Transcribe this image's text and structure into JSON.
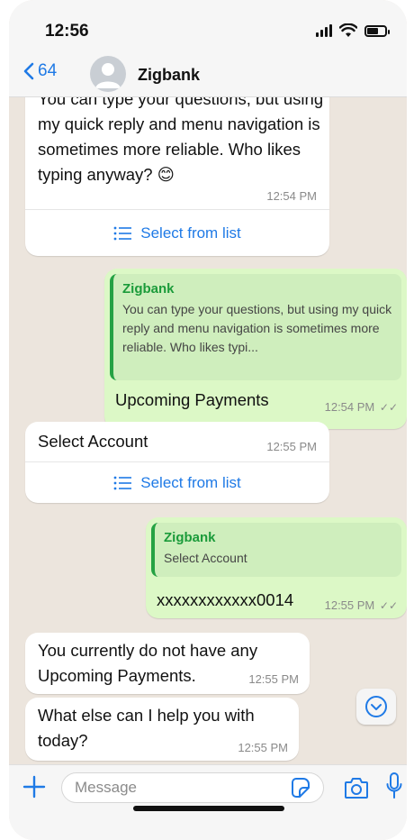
{
  "status": {
    "time": "12:56"
  },
  "nav": {
    "back_count": "64",
    "contact_name": "Zigbank"
  },
  "messages": {
    "m1": {
      "text": "You can type your questions, but using my quick reply and menu navigation is sometimes more reliable.  Who likes typing anyway? 😊",
      "time": "12:54 PM",
      "list_label": "Select from list"
    },
    "m2": {
      "quote_title": "Zigbank",
      "quote_text": "You can type your questions, but using my quick reply and menu navigation is sometimes more reliable.  Who likes typi...",
      "text": "Upcoming Payments",
      "time": "12:54 PM"
    },
    "m3": {
      "text": "Select Account",
      "time": "12:55 PM",
      "list_label": "Select from list"
    },
    "m4": {
      "quote_title": "Zigbank",
      "quote_text": "Select Account",
      "text": "xxxxxxxxxxxx0014",
      "time": "12:55 PM"
    },
    "m5": {
      "text": "You currently do not have any Upcoming Payments.",
      "time": "12:55 PM"
    },
    "m6": {
      "text": "What else can I help you with today?",
      "time": "12:55 PM"
    }
  },
  "composer": {
    "placeholder": "Message"
  },
  "colors": {
    "accent": "#1f7ae6",
    "outgoing_bubble": "#dcf8c6",
    "quote_green": "#1b9b3a",
    "chat_bg": "#ece5dd"
  },
  "icons": [
    "back-chevron-icon",
    "avatar-icon",
    "list-icon",
    "read-ticks-icon",
    "scroll-down-icon",
    "plus-icon",
    "sticker-icon",
    "camera-icon",
    "mic-icon"
  ]
}
